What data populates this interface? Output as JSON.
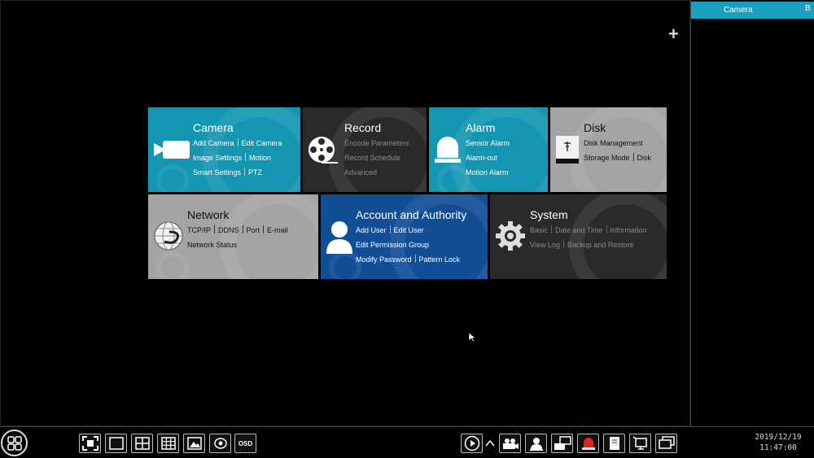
{
  "side_panel": {
    "tab_label": "Camera",
    "tab_partial": "B"
  },
  "tiles": {
    "camera": {
      "title": "Camera",
      "rows": [
        [
          "Add Camera",
          "Edit Camera"
        ],
        [
          "Image Settings",
          "Motion"
        ],
        [
          "Smart Settings",
          "PTZ"
        ]
      ]
    },
    "record": {
      "title": "Record",
      "rows": [
        [
          "Encode Parameters"
        ],
        [
          "Record Schedule"
        ],
        [
          "Advanced"
        ]
      ]
    },
    "alarm": {
      "title": "Alarm",
      "rows": [
        [
          "Sensor Alarm"
        ],
        [
          "Alarm-out"
        ],
        [
          "Motion Alarm"
        ]
      ]
    },
    "disk": {
      "title": "Disk",
      "rows": [
        [
          "Disk Management"
        ],
        [
          "Storage Mode",
          "Disk"
        ]
      ]
    },
    "network": {
      "title": "Network",
      "rows": [
        [
          "TCP/IP",
          "DDNS",
          "Port",
          "E-mail"
        ],
        [
          "Network Status"
        ]
      ]
    },
    "account": {
      "title": "Account and Authority",
      "rows": [
        [
          "Add User",
          "Edit User"
        ],
        [
          "Edit Permission Group"
        ],
        [
          "Modify Password",
          "Pattern Lock"
        ]
      ]
    },
    "system": {
      "title": "System",
      "rows": [
        [
          "Basic",
          "Date and Time",
          "Information"
        ],
        [
          "View Log",
          "Backup and Restore"
        ]
      ]
    }
  },
  "colors": {
    "teal": "#1496b2",
    "dark": "#2a2a2a",
    "gray": "#a4a4a4",
    "blue": "#114e96",
    "tab_accent": "#1aa0c0"
  },
  "taskbar": {
    "osd_label": "OSD",
    "date": "2019/12/19",
    "time": "11:47:00",
    "icons": [
      "fullscreen-icon",
      "single-view-icon",
      "quad-view-icon",
      "nine-view-icon",
      "image-adjust-icon",
      "sequence-icon",
      "osd-icon",
      "playback-icon",
      "expand-icon",
      "camera-record-icon",
      "user-icon",
      "network-icon",
      "alarm-icon",
      "disk-icon",
      "system-icon",
      "display-icon"
    ]
  }
}
